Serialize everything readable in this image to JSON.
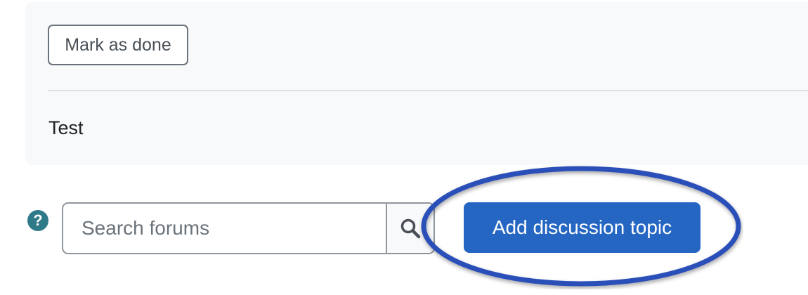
{
  "activity": {
    "mark_done_label": "Mark as done",
    "description": "Test"
  },
  "forum_controls": {
    "help_icon": "question-circle-icon",
    "help_glyph": "?",
    "search_placeholder": "Search forums",
    "search_value": "",
    "search_icon": "magnifier-icon",
    "add_topic_label": "Add discussion topic"
  },
  "annotation": {
    "highlight_color": "#2b4fb8"
  },
  "colors": {
    "primary": "#2466c2",
    "help": "#2f7a89",
    "card_background": "#f8f9fa"
  }
}
